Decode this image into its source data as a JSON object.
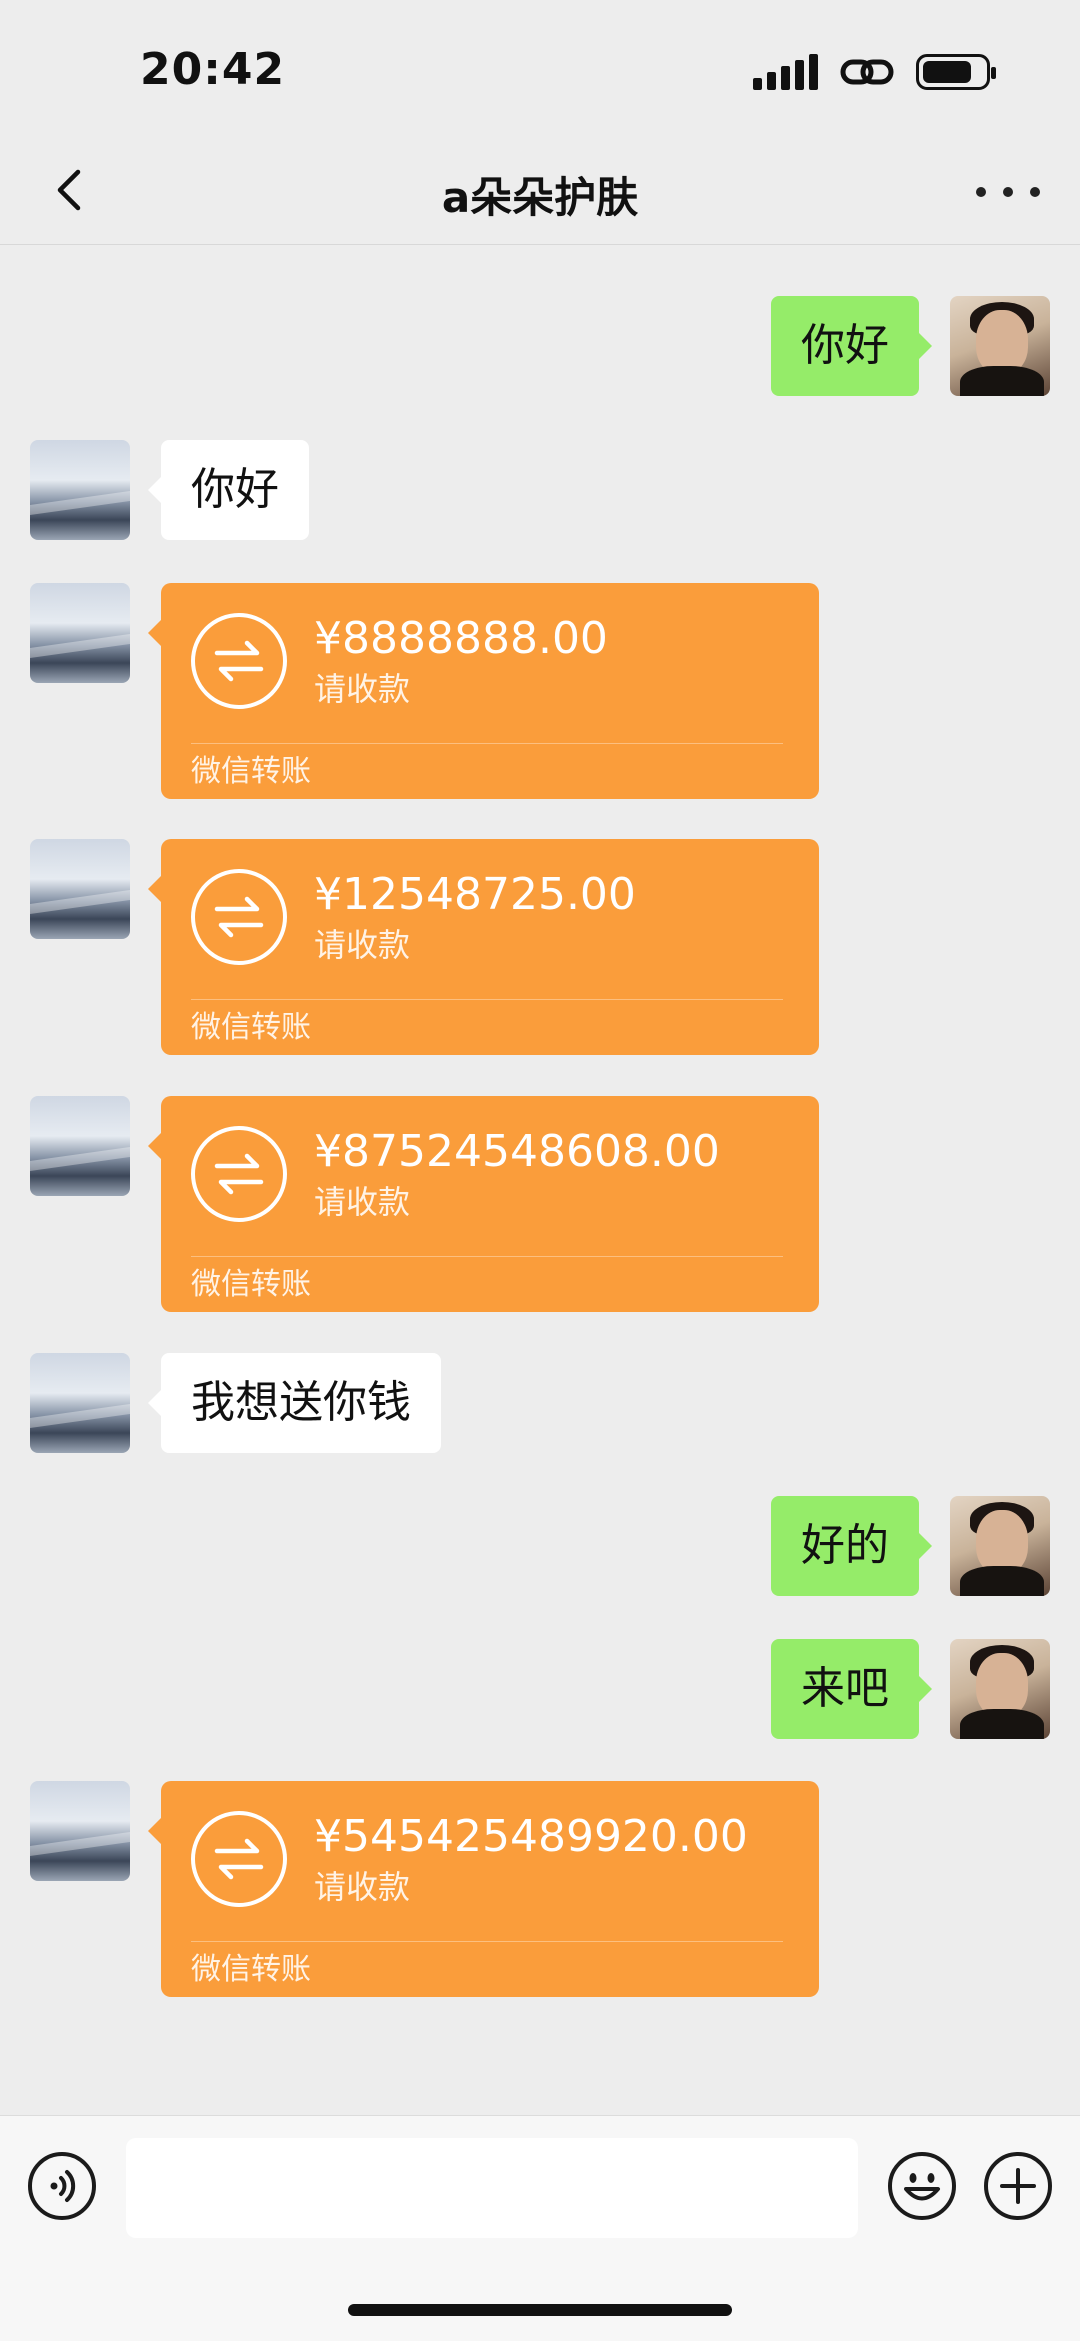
{
  "status_bar": {
    "time": "20:42",
    "icons": [
      "signal-icon",
      "link-icon",
      "battery-icon"
    ]
  },
  "header": {
    "title": "a朵朵护肤",
    "back_icon": "chevron-left-icon",
    "more_icon": "more-icon"
  },
  "colors": {
    "background": "#EDEDED",
    "my_bubble": "#95EC69",
    "their_bubble": "#FFFFFF",
    "transfer_card": "#FA9D3B"
  },
  "messages": [
    {
      "sender": "me",
      "type": "text",
      "text": "你好"
    },
    {
      "sender": "other",
      "type": "text",
      "text": "你好"
    },
    {
      "sender": "other",
      "type": "transfer",
      "amount": "¥8888888.00",
      "status": "请收款",
      "footer": "微信转账"
    },
    {
      "sender": "other",
      "type": "transfer",
      "amount": "¥12548725.00",
      "status": "请收款",
      "footer": "微信转账"
    },
    {
      "sender": "other",
      "type": "transfer",
      "amount": "¥87524548608.00",
      "status": "请收款",
      "footer": "微信转账"
    },
    {
      "sender": "other",
      "type": "text",
      "text": "我想送你钱"
    },
    {
      "sender": "me",
      "type": "text",
      "text": "好的"
    },
    {
      "sender": "me",
      "type": "text",
      "text": "来吧"
    },
    {
      "sender": "other",
      "type": "transfer",
      "amount": "¥545425489920.00",
      "status": "请收款",
      "footer": "微信转账"
    }
  ],
  "input_bar": {
    "text_value": "",
    "voice_icon": "voice-icon",
    "emoji_icon": "emoji-icon",
    "plus_icon": "plus-icon"
  }
}
